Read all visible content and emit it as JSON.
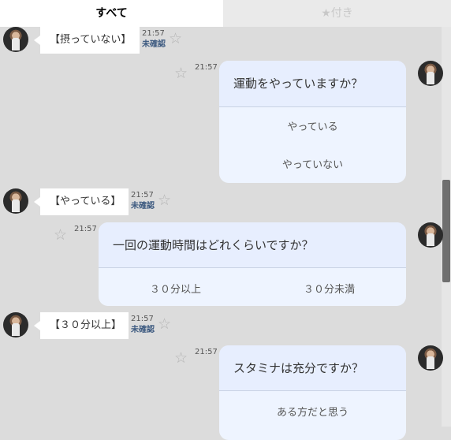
{
  "tabs": {
    "all": "すべて",
    "starred": "★付き"
  },
  "messages": [
    {
      "text": "【摂っていない】",
      "time": "21:57",
      "status": "未確認"
    },
    {
      "text": "【やっている】",
      "time": "21:57",
      "status": "未確認"
    },
    {
      "text": "【３０分以上】",
      "time": "21:57",
      "status": "未確認"
    }
  ],
  "questions": [
    {
      "time": "21:57",
      "question": "運動をやっていますか？",
      "options": [
        "やっている",
        "やっていない"
      ]
    },
    {
      "time": "21:57",
      "question": "一回の運動時間はどれくらいですか？",
      "options": [
        "３０分以上",
        "３０分未満"
      ]
    },
    {
      "time": "21:57",
      "question": "スタミナは充分ですか？",
      "options": [
        "ある方だと思う"
      ]
    }
  ],
  "icons": {
    "star": "star-outline-icon",
    "avatar": "user-avatar"
  },
  "colors": {
    "card_bg": "#eef4ff",
    "card_header": "#e7eefe",
    "unread": "#3d5a80",
    "background": "#dcdcdc"
  }
}
